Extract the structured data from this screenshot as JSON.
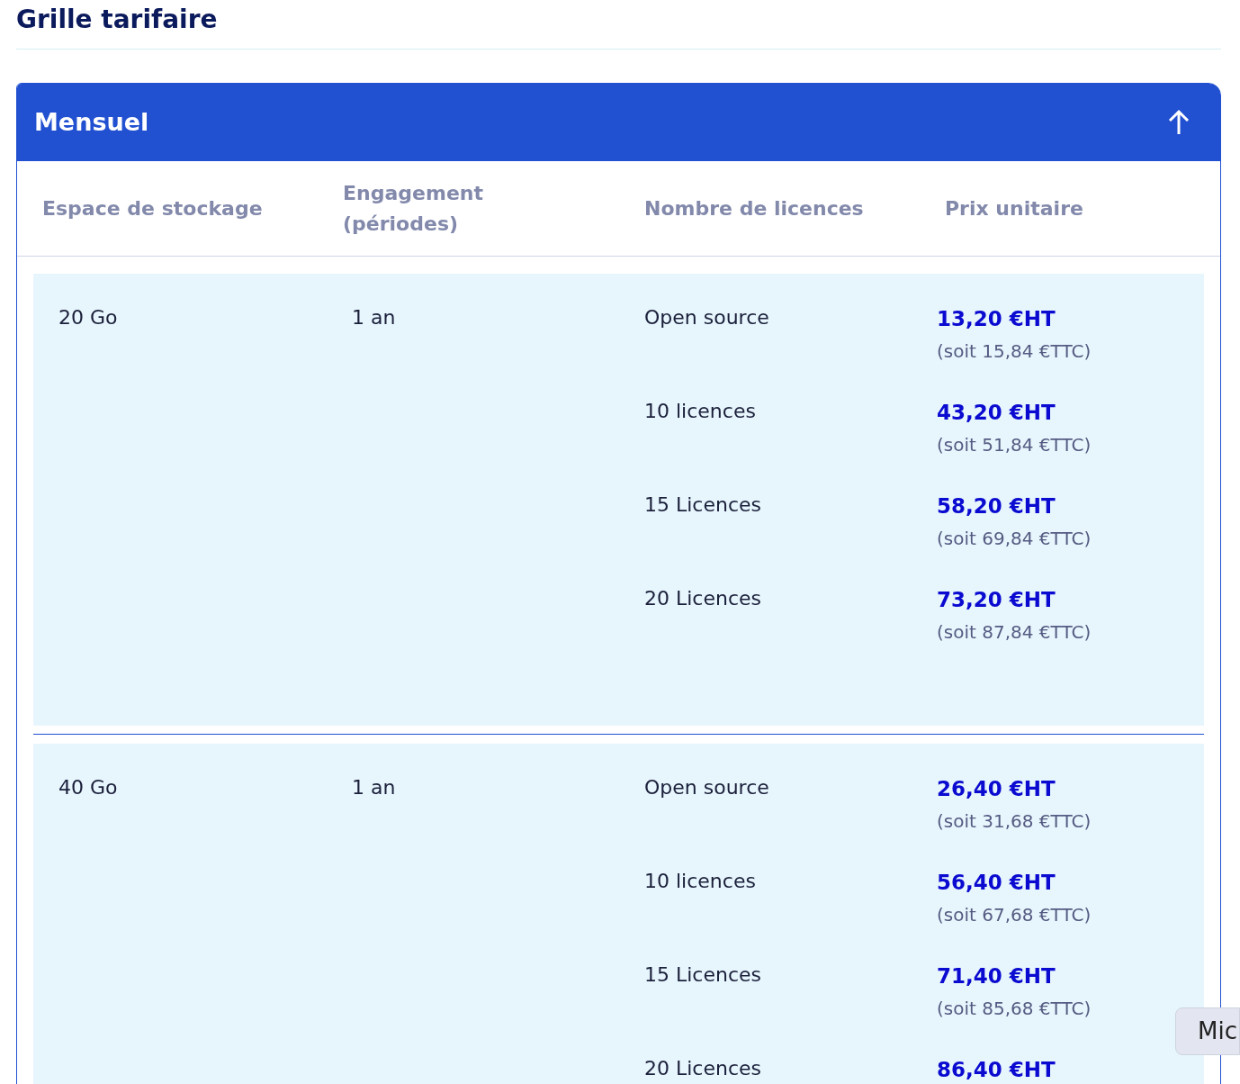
{
  "title": "Grille tarifaire",
  "section": {
    "title": "Mensuel",
    "expanded": true
  },
  "table": {
    "columns": [
      "Espace de stockage",
      "Engagement (périodes)",
      "Nombre de licences",
      "Prix unitaire"
    ],
    "groups": [
      {
        "storage": "20 Go",
        "commitment": "1 an",
        "options": [
          {
            "licences": "Open source",
            "price": "13,20 €HT",
            "price_ttc": "(soit 15,84 €TTC)"
          },
          {
            "licences": "10 licences",
            "price": "43,20 €HT",
            "price_ttc": "(soit 51,84 €TTC)"
          },
          {
            "licences": "15 Licences",
            "price": "58,20 €HT",
            "price_ttc": "(soit 69,84 €TTC)"
          },
          {
            "licences": "20 Licences",
            "price": "73,20 €HT",
            "price_ttc": "(soit 87,84 €TTC)"
          }
        ]
      },
      {
        "storage": "40 Go",
        "commitment": "1 an",
        "options": [
          {
            "licences": "Open source",
            "price": "26,40 €HT",
            "price_ttc": "(soit 31,68 €TTC)"
          },
          {
            "licences": "10 licences",
            "price": "56,40 €HT",
            "price_ttc": "(soit 67,68 €TTC)"
          },
          {
            "licences": "15 Licences",
            "price": "71,40 €HT",
            "price_ttc": "(soit 85,68 €TTC)"
          },
          {
            "licences": "20 Licences",
            "price": "86,40 €HT"
          }
        ]
      }
    ]
  },
  "side_tab": "Mic"
}
